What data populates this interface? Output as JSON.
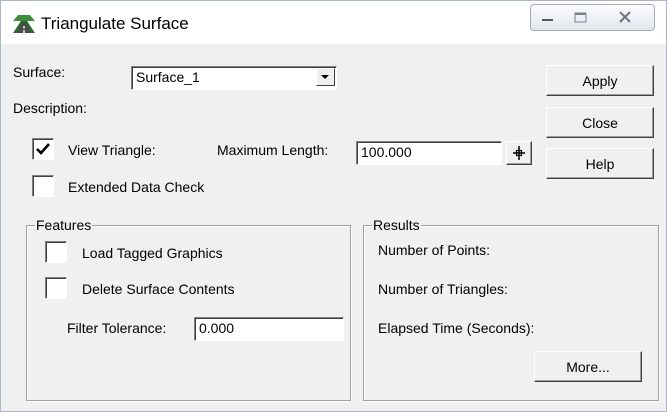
{
  "window": {
    "title": "Triangulate Surface"
  },
  "surface": {
    "label": "Surface:",
    "value": "Surface_1"
  },
  "description": {
    "label": "Description:"
  },
  "view_triangle": {
    "label": "View Triangle:",
    "checked": true
  },
  "max_length": {
    "label": "Maximum Length:",
    "value": "100.000"
  },
  "extended_check": {
    "label": "Extended Data Check",
    "checked": false
  },
  "features": {
    "title": "Features",
    "load_tagged": {
      "label": "Load Tagged Graphics",
      "checked": false
    },
    "delete_contents": {
      "label": "Delete Surface Contents",
      "checked": false
    },
    "filter_tolerance": {
      "label": "Filter Tolerance:",
      "value": "0.000"
    }
  },
  "results": {
    "title": "Results",
    "points_label": "Number of Points:",
    "triangles_label": "Number of Triangles:",
    "elapsed_label": "Elapsed Time (Seconds):",
    "more_label": "More..."
  },
  "buttons": {
    "apply": "Apply",
    "close": "Close",
    "help": "Help"
  },
  "icons": {
    "app": "road-surface-icon",
    "minimize": "minimize-icon",
    "maximize": "maximize-icon",
    "close": "close-icon",
    "dropdown": "chevron-down-icon",
    "pick": "crosshair-icon",
    "check": "check-mark-icon"
  }
}
